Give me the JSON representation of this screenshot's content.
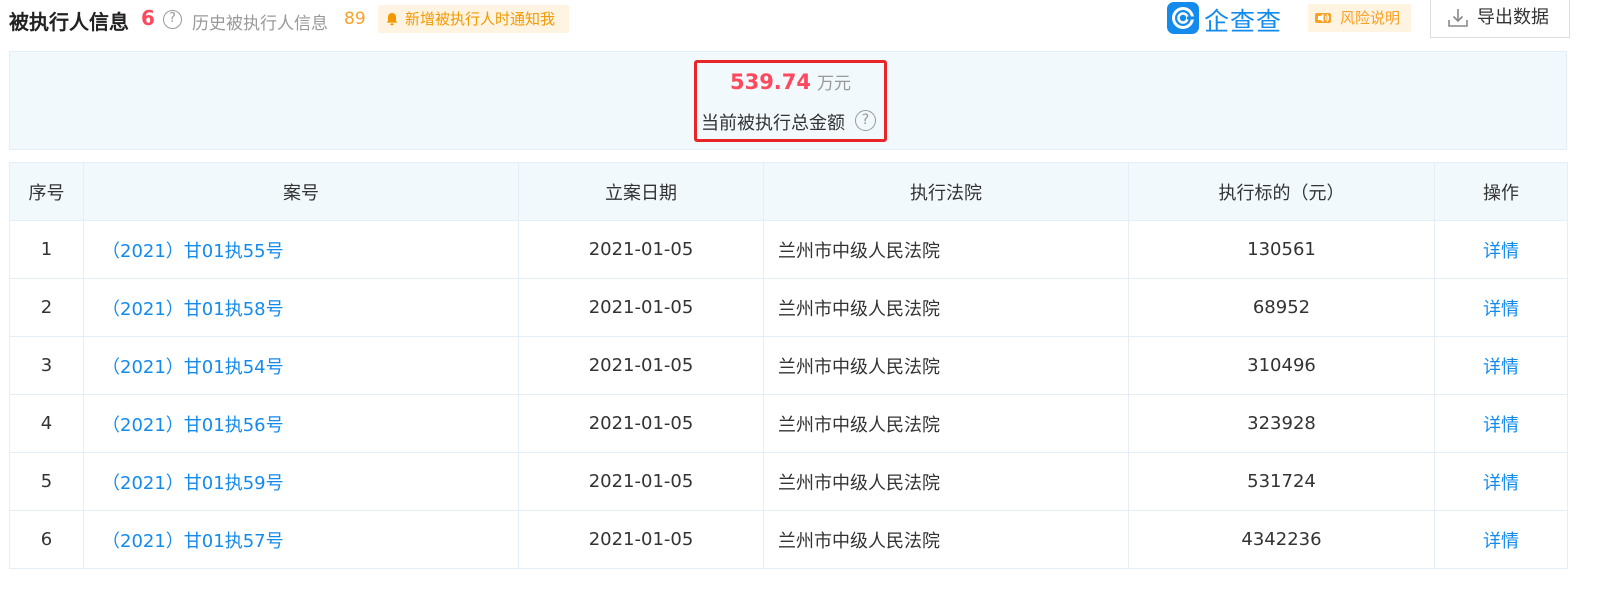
{
  "header": {
    "title": "被执行人信息",
    "count": "6",
    "help_glyph": "?",
    "history_label": "历史被执行人信息",
    "history_count": "89",
    "notify_label": "新增被执行人时通知我",
    "logo_text": "企查查",
    "risk_label": "风险说明",
    "export_label": "导出数据"
  },
  "summary": {
    "amount": "539.74",
    "unit": "万元",
    "label": "当前被执行总金额",
    "help_glyph": "?"
  },
  "table": {
    "headers": [
      "序号",
      "案号",
      "立案日期",
      "执行法院",
      "执行标的（元）",
      "操作"
    ],
    "rows": [
      {
        "index": "1",
        "case_no": "（2021）甘01执55号",
        "date": "2021-01-05",
        "court": "兰州市中级人民法院",
        "amount": "130561",
        "action": "详情"
      },
      {
        "index": "2",
        "case_no": "（2021）甘01执58号",
        "date": "2021-01-05",
        "court": "兰州市中级人民法院",
        "amount": "68952",
        "action": "详情"
      },
      {
        "index": "3",
        "case_no": "（2021）甘01执54号",
        "date": "2021-01-05",
        "court": "兰州市中级人民法院",
        "amount": "310496",
        "action": "详情"
      },
      {
        "index": "4",
        "case_no": "（2021）甘01执56号",
        "date": "2021-01-05",
        "court": "兰州市中级人民法院",
        "amount": "323928",
        "action": "详情"
      },
      {
        "index": "5",
        "case_no": "（2021）甘01执59号",
        "date": "2021-01-05",
        "court": "兰州市中级人民法院",
        "amount": "531724",
        "action": "详情"
      },
      {
        "index": "6",
        "case_no": "（2021）甘01执57号",
        "date": "2021-01-05",
        "court": "兰州市中级人民法院",
        "amount": "4342236",
        "action": "详情"
      }
    ]
  },
  "icons": {
    "help": "question-circle-icon",
    "notify": "bell-icon",
    "logo": "qichacha-logo-icon",
    "risk": "speaker-icon",
    "export": "download-icon"
  },
  "colors": {
    "accent_blue": "#128bed",
    "highlight_red": "#fd485e",
    "orange": "#f9a026",
    "box_red": "#e8262a",
    "panel_bg": "#f2f9fc"
  }
}
